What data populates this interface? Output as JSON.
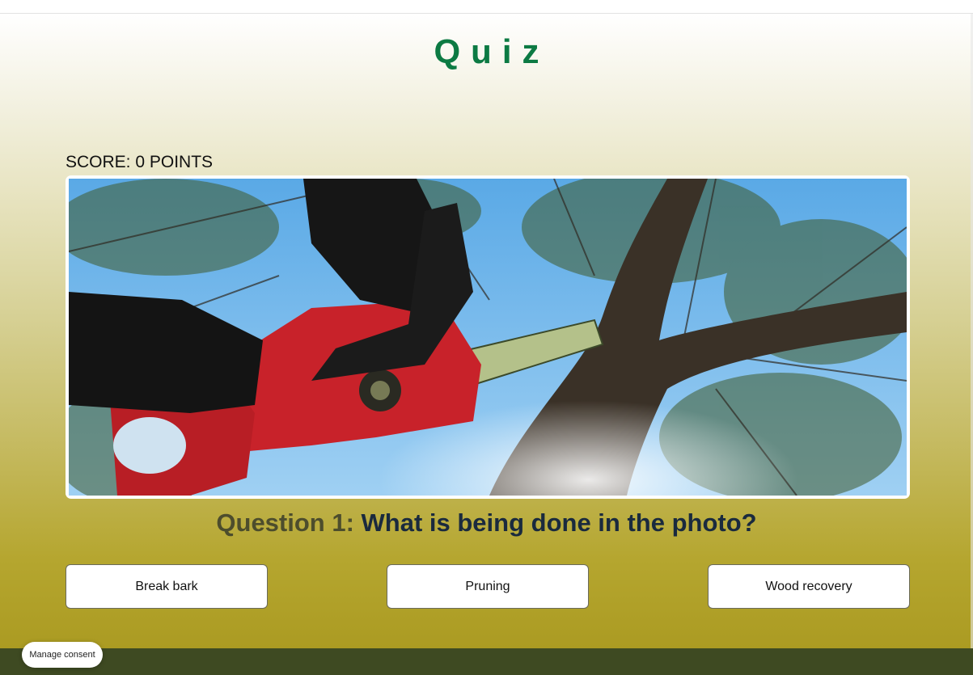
{
  "page": {
    "title": "Quiz",
    "score_text": "SCORE: 0 POINTS"
  },
  "photo": {
    "subject": "chainsaw-cutting-tree-branch"
  },
  "question": {
    "number_label": "Question 1:",
    "text": "What is being done in the photo?"
  },
  "answers": [
    {
      "label": "Break bark"
    },
    {
      "label": "Pruning"
    },
    {
      "label": "Wood recovery"
    }
  ],
  "consent": {
    "label": "Manage consent"
  },
  "colors": {
    "title": "#0c7a43",
    "footer": "#3e4a22",
    "gradient_bottom": "#ab9b22"
  }
}
